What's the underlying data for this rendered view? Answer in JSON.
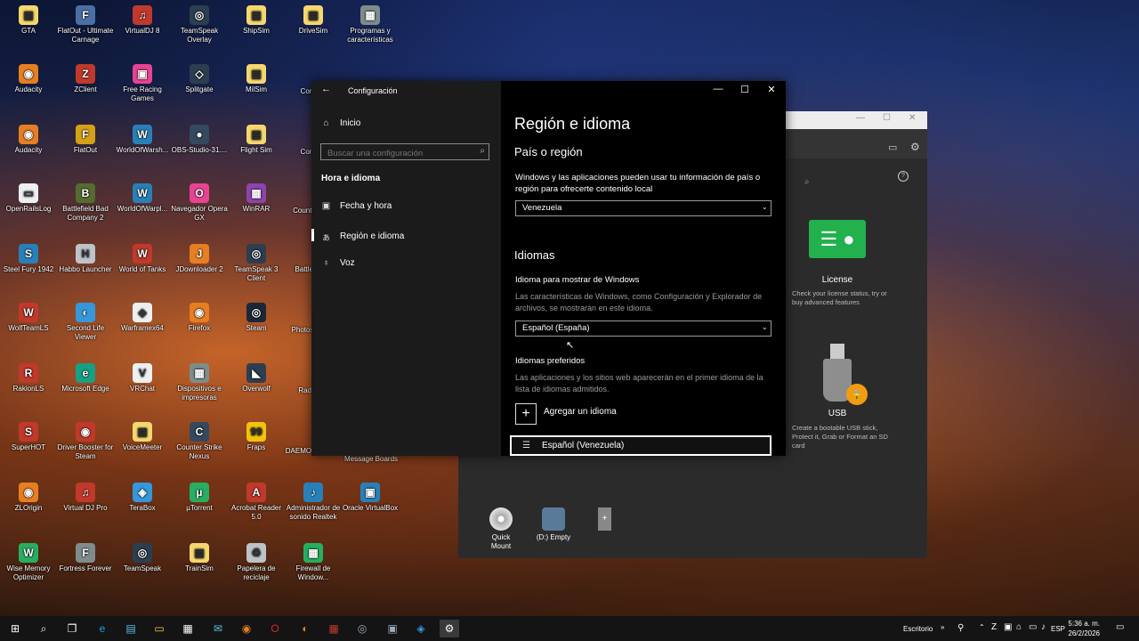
{
  "desktop": {
    "icons": [
      {
        "label": "GTA",
        "color": "#f5d76e",
        "glyph": "▤"
      },
      {
        "label": "FlatOut - Ultimate Carnage",
        "color": "#4a6fa5",
        "glyph": "F"
      },
      {
        "label": "VirtualDJ 8",
        "color": "#c0392b",
        "glyph": "♫"
      },
      {
        "label": "TeamSpeak Overlay",
        "color": "#2c3e50",
        "glyph": "◎"
      },
      {
        "label": "ShipSim",
        "color": "#f5d76e",
        "glyph": "▤"
      },
      {
        "label": "DriveSim",
        "color": "#f5d76e",
        "glyph": "▤"
      },
      {
        "label": "Programas y características",
        "color": "#7f8c8d",
        "glyph": "▦"
      },
      {
        "label": "Audacity",
        "color": "#e67e22",
        "glyph": "◉"
      },
      {
        "label": "ZClient",
        "color": "#c0392b",
        "glyph": "Z"
      },
      {
        "label": "Free Racing Games",
        "color": "#e84393",
        "glyph": "▣"
      },
      {
        "label": "Splitgate",
        "color": "#2c3e50",
        "glyph": "◇"
      },
      {
        "label": "MilSim",
        "color": "#f5d76e",
        "glyph": "▤"
      },
      {
        "label": "Audacity",
        "color": "#e67e22",
        "glyph": "◉"
      },
      {
        "label": "FlatOut",
        "color": "#d4a017",
        "glyph": "F"
      },
      {
        "label": "WorldOfWarsh...",
        "color": "#2980b9",
        "glyph": "W"
      },
      {
        "label": "OBS-Studio-31....",
        "color": "#34495e",
        "glyph": "●"
      },
      {
        "label": "Flight Sim",
        "color": "#f5d76e",
        "glyph": "▤"
      },
      {
        "label": "OpenRailsLog",
        "color": "#ecf0f1",
        "glyph": "▭"
      },
      {
        "label": "Battlefield Bad Company 2",
        "color": "#556b2f",
        "glyph": "B"
      },
      {
        "label": "WorldOfWarpl...",
        "color": "#2980b9",
        "glyph": "W"
      },
      {
        "label": "Navegador Opera GX",
        "color": "#e84393",
        "glyph": "O"
      },
      {
        "label": "WinRAR",
        "color": "#8e44ad",
        "glyph": "▦"
      },
      {
        "label": "Steel Fury 1942",
        "color": "#2980b9",
        "glyph": "S"
      },
      {
        "label": "Habbo Launcher",
        "color": "#bdc3c7",
        "glyph": "H"
      },
      {
        "label": "World of Tanks",
        "color": "#c0392b",
        "glyph": "W"
      },
      {
        "label": "JDownloader 2",
        "color": "#e67e22",
        "glyph": "J"
      },
      {
        "label": "TeamSpeak 3 Client",
        "color": "#2c3e50",
        "glyph": "◎"
      },
      {
        "label": "WolfTeamLS",
        "color": "#c0392b",
        "glyph": "W"
      },
      {
        "label": "Second Life Viewer",
        "color": "#3498db",
        "glyph": "◐"
      },
      {
        "label": "Warframex64",
        "color": "#ecf0f1",
        "glyph": "◆"
      },
      {
        "label": "Firefox",
        "color": "#e67e22",
        "glyph": "◉"
      },
      {
        "label": "Steam",
        "color": "#1b2838",
        "glyph": "◎"
      },
      {
        "label": "RakionLS",
        "color": "#c0392b",
        "glyph": "R"
      },
      {
        "label": "Microsoft Edge",
        "color": "#16a085",
        "glyph": "e"
      },
      {
        "label": "VRChat",
        "color": "#ecf0f1",
        "glyph": "V"
      },
      {
        "label": "Dispositivos e impresoras",
        "color": "#7f8c8d",
        "glyph": "▦"
      },
      {
        "label": "Overwolf",
        "color": "#2c3e50",
        "glyph": "◣"
      },
      {
        "label": "SuperHOT",
        "color": "#c0392b",
        "glyph": "S"
      },
      {
        "label": "Driver Booster for Steam",
        "color": "#c0392b",
        "glyph": "◉"
      },
      {
        "label": "VoiceMeeter",
        "color": "#f5d76e",
        "glyph": "▤"
      },
      {
        "label": "Counter Strike Nexus",
        "color": "#34495e",
        "glyph": "C"
      },
      {
        "label": "Fraps",
        "color": "#f1c40f",
        "glyph": "99"
      },
      {
        "label": "ZLOrigin",
        "color": "#e67e22",
        "glyph": "◉"
      },
      {
        "label": "Virtual DJ Pro",
        "color": "#c0392b",
        "glyph": "♫"
      },
      {
        "label": "TeraBox",
        "color": "#3498db",
        "glyph": "◈"
      },
      {
        "label": "µTorrent",
        "color": "#27ae60",
        "glyph": "µ"
      },
      {
        "label": "Acrobat Reader 5.0",
        "color": "#c0392b",
        "glyph": "A"
      },
      {
        "label": "Administrador de sonido Realtek",
        "color": "#2980b9",
        "glyph": "♪"
      },
      {
        "label": "Oracle VirtualBox",
        "color": "#2980b9",
        "glyph": "▣"
      },
      {
        "label": "Wise Memory Optimizer",
        "color": "#27ae60",
        "glyph": "W"
      },
      {
        "label": "Fortress Forever",
        "color": "#7f8c8d",
        "glyph": "F"
      },
      {
        "label": "TeamSpeak",
        "color": "#2c3e50",
        "glyph": "◎"
      },
      {
        "label": "TrainSim",
        "color": "#f5d76e",
        "glyph": "▤"
      },
      {
        "label": "Papelera de reciclaje",
        "color": "#bdc3c7",
        "glyph": "♻"
      },
      {
        "label": "Firewall de Window...",
        "color": "#27ae60",
        "glyph": "▦"
      }
    ],
    "partial_labels": [
      "Cont",
      "Cont",
      "Count Ne",
      "Battle G",
      "Photos Po",
      "Radm",
      "DAEMO Lite",
      "Message Boards"
    ]
  },
  "settings": {
    "window_title": "Configuración",
    "nav": {
      "home": "Inicio",
      "search_placeholder": "Buscar una configuración",
      "section_title": "Hora e idioma",
      "items": [
        {
          "label": "Fecha y hora",
          "icon": "calendar-clock-icon"
        },
        {
          "label": "Región e idioma",
          "icon": "language-icon"
        },
        {
          "label": "Voz",
          "icon": "microphone-icon"
        }
      ]
    },
    "content": {
      "page_title": "Región e idioma",
      "country_heading": "País o región",
      "country_desc": "Windows y las aplicaciones pueden usar tu información de país o región para ofrecerte contenido local",
      "country_value": "Venezuela",
      "languages_heading": "Idiomas",
      "display_lang_label": "Idioma para mostrar de Windows",
      "display_lang_desc": "Las características de Windows, como Configuración y Explorador de archivos, se mostrarán en este idioma.",
      "display_lang_value": "Español (España)",
      "preferred_label": "Idiomas preferidos",
      "preferred_desc": "Las aplicaciones y los sitios web aparecerán en el primer idioma de la lista de idiomas admitidos.",
      "add_language": "Agregar un idioma",
      "language_entry": "Español (Venezuela)"
    }
  },
  "background_app": {
    "license_title": "License",
    "license_desc": "Check your license status, try or buy advanced features",
    "usb_title": "USB",
    "usb_desc": "Create a bootable USB stick, Protect it, Grab or Format an SD card",
    "dock": [
      {
        "label": "Quick Mount"
      },
      {
        "label": "(D:) Empty"
      }
    ]
  },
  "taskbar": {
    "desktop_label": "Escritorio",
    "language": "ESP",
    "time": "5:36 a. m.",
    "date": "26/2/2026"
  }
}
